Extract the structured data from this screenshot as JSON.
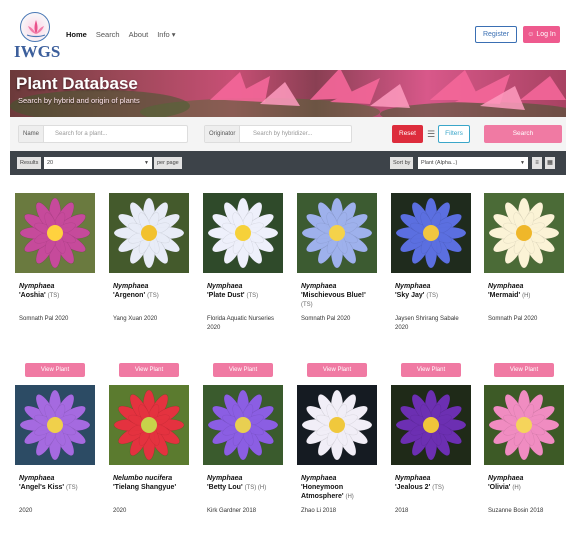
{
  "header": {
    "logo_text": "IWGS",
    "nav": [
      {
        "label": "Home",
        "active": true
      },
      {
        "label": "Search"
      },
      {
        "label": "About"
      },
      {
        "label": "Info ▾"
      }
    ],
    "register_label": "Register",
    "login_label": "Log In"
  },
  "banner": {
    "title": "Plant Database",
    "subtitle": "Search by hybrid and origin of plants"
  },
  "search": {
    "name_label": "Name",
    "name_placeholder": "Search for a plant...",
    "originator_label": "Originator",
    "originator_placeholder": "Search by hybridizer...",
    "reset_label": "Reset",
    "filters_label": "Filters",
    "search_label": "Search"
  },
  "results": {
    "results_label": "Results",
    "results_value": "20",
    "per_page_label": "per page",
    "sort_label": "Sort by",
    "sort_value": "Plant (Alpha...)"
  },
  "colors": {
    "accent": "#f07aa3",
    "reset": "#dd2c3c",
    "filters": "#3aa6c9",
    "register": "#3a6fb3",
    "resultsbar": "#3d4349"
  },
  "view_label": "View Plant",
  "plants": [
    {
      "genus": "Nymphaea",
      "cultivar": "'Aoshia'",
      "code": "(TS)",
      "hybridizer": "Somnath Pal 2020",
      "petal": "#c64a9b",
      "center": "#ffd23f",
      "bg": "#6a7a3f"
    },
    {
      "genus": "Nymphaea",
      "cultivar": "'Argenon'",
      "code": "(TS)",
      "hybridizer": "Yang Xuan 2020",
      "petal": "#e8ecf7",
      "center": "#f2c12e",
      "bg": "#445a2c"
    },
    {
      "genus": "Nymphaea",
      "cultivar": "'Plate Dust'",
      "code": "(TS)",
      "hybridizer": "Florida Aquatic Nurseries 2020",
      "petal": "#eef0fb",
      "center": "#f6d13a",
      "bg": "#2f4a2a"
    },
    {
      "genus": "Nymphaea",
      "cultivar": "'Mischievous Blue!'",
      "code": "(TS)",
      "hybridizer": "Somnath Pal 2020",
      "petal": "#9eb1ec",
      "center": "#f4d24a",
      "bg": "#3c5b31"
    },
    {
      "genus": "Nymphaea",
      "cultivar": "'Sky Jay'",
      "code": "(TS)",
      "hybridizer": "Jaysen Shrirang Sabale 2020",
      "petal": "#5b6fe0",
      "center": "#f1c640",
      "bg": "#1f2b1d"
    },
    {
      "genus": "Nymphaea",
      "cultivar": "'Mermaid'",
      "code": "(H)",
      "hybridizer": "Somnath Pal 2020",
      "petal": "#fbf3d6",
      "center": "#efb72a",
      "bg": "#4b6b37"
    },
    {
      "genus": "Nymphaea",
      "cultivar": "'Angel's Kiss'",
      "code": "(TS)",
      "hybridizer": "2020",
      "petal": "#a56ae0",
      "center": "#f0d04b",
      "bg": "#2c4b64"
    },
    {
      "genus": "Nelumbo nucifera",
      "cultivar": "'Tielang Shangyue'",
      "code": "",
      "hybridizer": "2020",
      "petal": "#e4323f",
      "center": "#c7d24a",
      "bg": "#5b7b2f"
    },
    {
      "genus": "Nymphaea",
      "cultivar": "'Betty Lou'",
      "code": "(TS) (H)",
      "hybridizer": "Kirk Gardner 2018",
      "petal": "#8b5ee3",
      "center": "#e8cf51",
      "bg": "#3a5b2d"
    },
    {
      "genus": "Nymphaea",
      "cultivar": "'Honeymoon Atmosphere'",
      "code": "(H)",
      "hybridizer": "Zhao Li 2018",
      "petal": "#f1eef7",
      "center": "#f0c83c",
      "bg": "#151b22"
    },
    {
      "genus": "Nymphaea",
      "cultivar": "'Jealous 2'",
      "code": "(TS)",
      "hybridizer": "2018",
      "petal": "#6c2fb2",
      "center": "#f0c53a",
      "bg": "#1f2a18"
    },
    {
      "genus": "Nymphaea",
      "cultivar": "'Olivia'",
      "code": "(H)",
      "hybridizer": "Suzanne Bosin 2018",
      "petal": "#f08cc1",
      "center": "#f5d45b",
      "bg": "#3d5a26"
    }
  ]
}
